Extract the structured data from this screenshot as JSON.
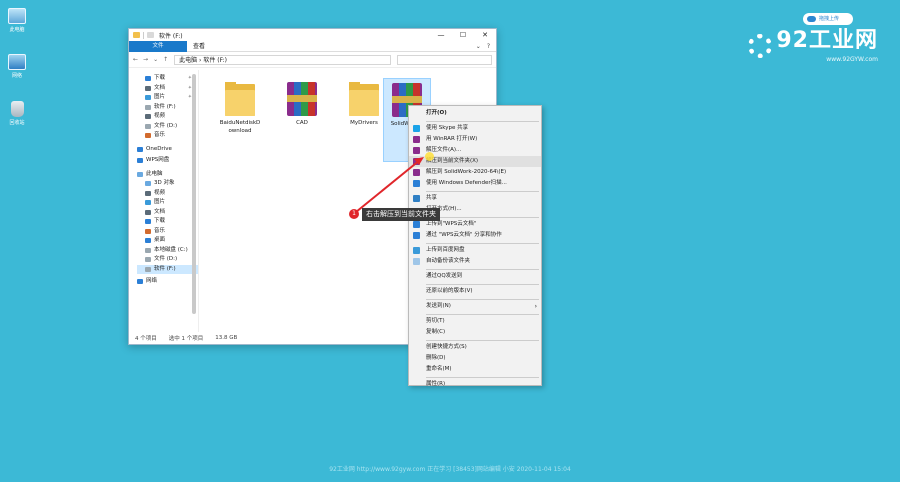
{
  "desktop": {
    "icons": [
      {
        "label": "此电脑"
      },
      {
        "label": "网络"
      },
      {
        "label": "回收站"
      }
    ],
    "upload_badge": "拖拽上传",
    "logo_text": "92工业网",
    "logo_sub": "www.92GYW.com",
    "watermark": "92工业网 http://www.92gyw.com 正在学习 [38453]网站编辑 小安 2020-11-04 15:04"
  },
  "window": {
    "title": "软件 (F:)",
    "controls": {
      "minimize": "—",
      "maximize": "☐",
      "close": "✕"
    },
    "ribbon_tabs": [
      "文件",
      "主页",
      "共享",
      "查看"
    ],
    "address": "此电脑 › 软件 (F:)",
    "status": {
      "count": "4 个项目",
      "selected": "选中 1 个项目",
      "size": "13.8 GB"
    }
  },
  "nav": [
    {
      "label": "下载",
      "pin": "✦"
    },
    {
      "label": "文档",
      "pin": "✦"
    },
    {
      "label": "图片",
      "pin": "✦"
    },
    {
      "label": "软件 (F:)",
      "pin": ""
    },
    {
      "label": "视频",
      "pin": ""
    },
    {
      "label": "文件 (D:)",
      "pin": ""
    },
    {
      "label": "音乐",
      "pin": ""
    },
    {
      "label": "OneDrive",
      "pin": ""
    },
    {
      "label": "WPS网盘",
      "pin": ""
    },
    {
      "label": "此电脑",
      "pin": ""
    },
    {
      "label": "3D 对象",
      "pin": ""
    },
    {
      "label": "视频",
      "pin": ""
    },
    {
      "label": "图片",
      "pin": ""
    },
    {
      "label": "文档",
      "pin": ""
    },
    {
      "label": "下载",
      "pin": ""
    },
    {
      "label": "音乐",
      "pin": ""
    },
    {
      "label": "桌面",
      "pin": ""
    },
    {
      "label": "本地磁盘 (C:)",
      "pin": ""
    },
    {
      "label": "文件 (D:)",
      "pin": ""
    },
    {
      "label": "软件 (F:)",
      "pin": ""
    },
    {
      "label": "网络",
      "pin": ""
    }
  ],
  "files": [
    {
      "name": "BaiduNetdiskD ownload",
      "type": "folder"
    },
    {
      "name": "CAD",
      "type": "rar"
    },
    {
      "name": "MyDrivers",
      "type": "folder"
    },
    {
      "name": "SolidWo 0-6",
      "type": "rar"
    }
  ],
  "context_menu": {
    "items": [
      {
        "label": "打开(O)",
        "bold": true
      },
      {
        "label": "使用 Skype 共享"
      },
      {
        "label": "用 WinRAR 打开(W)"
      },
      {
        "label": "解压文件(A)..."
      },
      {
        "label": "解压到当前文件夹(X)"
      },
      {
        "label": "解压到 SolidWork-2020-64\\(E)"
      },
      {
        "label": "使用 Windows Defender扫描..."
      },
      {
        "label": "共享"
      },
      {
        "label": "打开方式(H)..."
      },
      {
        "label": "上传到\"WPS云文档\""
      },
      {
        "label": "通过 \"WPS云文档\" 分享和协作"
      },
      {
        "label": "上传到百度网盘"
      },
      {
        "label": "自动备份该文件夹"
      },
      {
        "label": "通过QQ发送到"
      },
      {
        "label": "还原以前的版本(V)"
      },
      {
        "label": "发送到(N)"
      },
      {
        "label": "剪切(T)"
      },
      {
        "label": "复制(C)"
      },
      {
        "label": "创建快捷方式(S)"
      },
      {
        "label": "删除(D)"
      },
      {
        "label": "重命名(M)"
      },
      {
        "label": "属性(R)"
      }
    ],
    "submenu_arrow": "›"
  },
  "callout": {
    "number": "1",
    "text": "右击解压到当前文件夹"
  }
}
